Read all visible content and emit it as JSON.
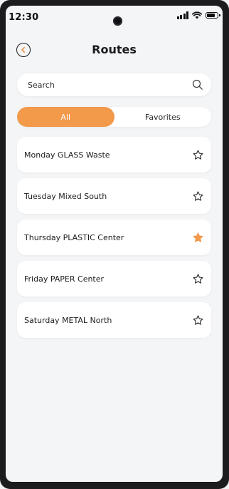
{
  "status_bar": {
    "time": "12:30"
  },
  "header": {
    "title": "Routes",
    "back_icon": "chevron-left-circle-icon"
  },
  "search": {
    "placeholder": "Search",
    "icon": "search-icon"
  },
  "tabs": [
    {
      "label": "All",
      "active": true
    },
    {
      "label": "Favorites",
      "active": false
    }
  ],
  "routes": [
    {
      "name": "Monday GLASS Waste",
      "favorite": false
    },
    {
      "name": "Tuesday Mixed South",
      "favorite": false
    },
    {
      "name": "Thursday PLASTIC Center",
      "favorite": true
    },
    {
      "name": "Friday PAPER Center",
      "favorite": false
    },
    {
      "name": "Saturday METAL North",
      "favorite": false
    }
  ],
  "colors": {
    "accent": "#f2994a",
    "background": "#f4f5f7",
    "card": "#ffffff",
    "text": "#1c1c1e"
  }
}
